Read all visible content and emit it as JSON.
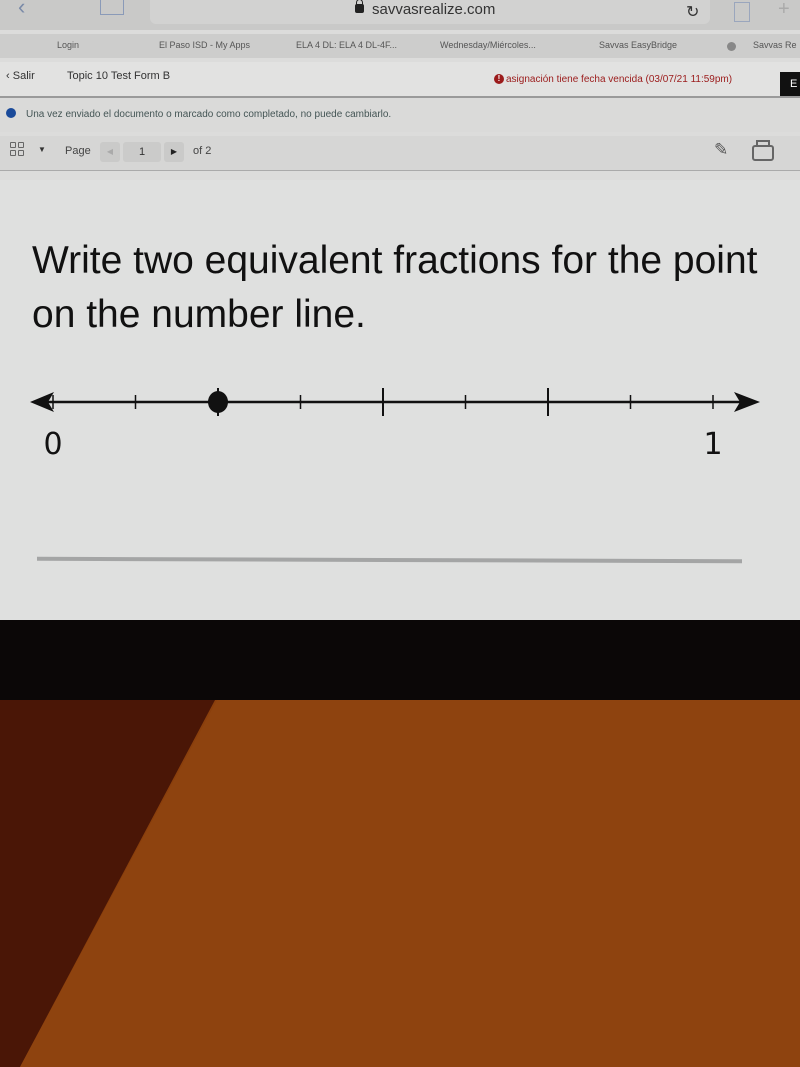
{
  "browser": {
    "url": "savvasrealize.com",
    "bookmarks": [
      "Login",
      "El Paso ISD - My Apps",
      "ELA 4 DL: ELA 4 DL-4F...",
      "Wednesday/Miércoles...",
      "Savvas EasyBridge",
      "Savvas Re"
    ]
  },
  "assignment": {
    "back_label": "Salir",
    "title": "Topic 10 Test Form B",
    "due_notice": "asignación tiene fecha vencida (03/07/21 11:59pm)",
    "end_button": "E",
    "colors": {
      "due_text": "#9b1b1b",
      "info_icon": "#1a4a9a"
    }
  },
  "notice": {
    "text": "Una vez enviado el documento o marcado como completado, no puede cambiarlo."
  },
  "toolbar": {
    "page_label": "Page",
    "current_page": "1",
    "of_label": "of 2"
  },
  "question": {
    "text": "Write two equivalent fractions for the point on the number line.",
    "answer_value": ""
  },
  "chart_data": {
    "type": "number-line",
    "min": 0,
    "max": 1,
    "divisions": 8,
    "major_ticks": [
      0.25,
      0.5,
      0.75
    ],
    "point": 0.25,
    "labels": [
      {
        "value": 0,
        "text": "0"
      },
      {
        "value": 1,
        "text": "1"
      }
    ]
  }
}
